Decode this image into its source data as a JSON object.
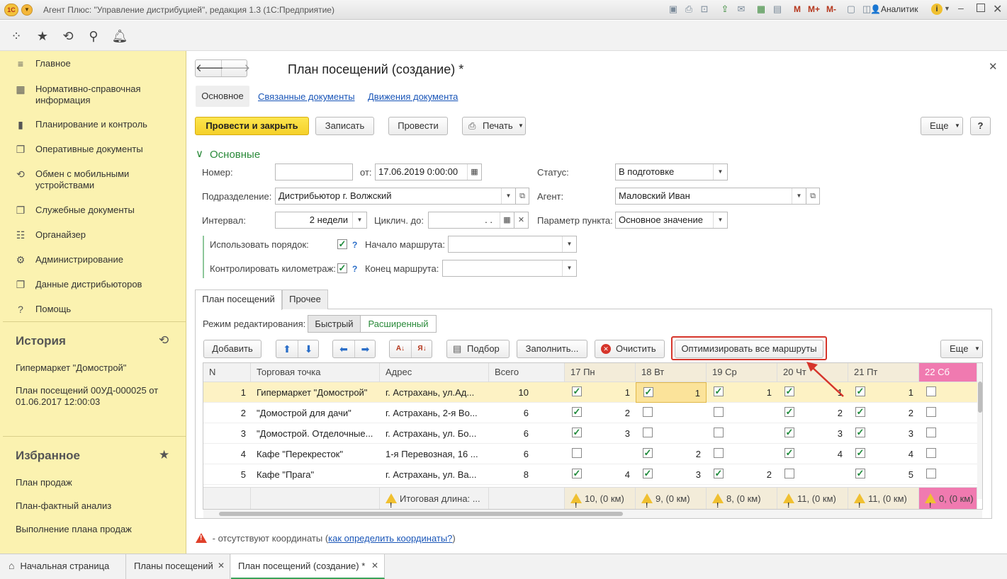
{
  "window": {
    "title": "Агент Плюс: \"Управление дистрибуцией\", редакция 1.3  (1С:Предприятие)",
    "user": "Аналитик",
    "logo_text": "1С",
    "toolbar_memory": [
      "M",
      "M+",
      "M-"
    ]
  },
  "sidebar": {
    "nav": [
      {
        "icon": "≡",
        "label": "Главное"
      },
      {
        "icon": "▦",
        "label": "Нормативно-справочная информация"
      },
      {
        "icon": "▮",
        "label": "Планирование и контроль"
      },
      {
        "icon": "❐",
        "label": "Оперативные документы"
      },
      {
        "icon": "⟲",
        "label": "Обмен с мобильными устройствами"
      },
      {
        "icon": "❐",
        "label": "Служебные документы"
      },
      {
        "icon": "☷",
        "label": "Органайзер"
      },
      {
        "icon": "⚙",
        "label": "Администрирование"
      },
      {
        "icon": "❐",
        "label": "Данные дистрибьюторов"
      },
      {
        "icon": "?",
        "label": "Помощь"
      }
    ],
    "history": {
      "title": "История",
      "items": [
        "Гипермаркет \"Домострой\"",
        "План посещений 00УД-000025 от 01.06.2017 12:00:03"
      ]
    },
    "favorites": {
      "title": "Избранное",
      "items": [
        "План продаж",
        "План-фактный анализ",
        "Выполнение плана продаж"
      ]
    }
  },
  "doc": {
    "title": "План посещений  (создание) *",
    "tabs": [
      "Основное",
      "Связанные документы",
      "Движения документа"
    ],
    "buttons": {
      "post_close": "Провести и закрыть",
      "save": "Записать",
      "post": "Провести",
      "print": "Печать",
      "more": "Еще",
      "help": "?"
    },
    "group_title": "Основные",
    "fields": {
      "number_label": "Номер:",
      "number_value": "",
      "date_label": "от:",
      "date_value": "17.06.2019  0:00:00",
      "status_label": "Статус:",
      "status_value": "В подготовке",
      "division_label": "Подразделение:",
      "division_value": "Дистрибьютор г. Волжский",
      "agent_label": "Агент:",
      "agent_value": "Маловский Иван",
      "interval_label": "Интервал:",
      "interval_value": "2 недели",
      "cyclic_label": "Циклич. до:",
      "cyclic_value": " .  .",
      "point_param_label": "Параметр пункта:",
      "point_param_value": "Основное значение",
      "use_order_label": "Использовать порядок:",
      "use_order_checked": true,
      "control_km_label": "Контролировать километраж:",
      "control_km_checked": true,
      "route_start_label": "Начало маршрута:",
      "route_start_value": "",
      "route_end_label": "Конец маршрута:",
      "route_end_value": "",
      "q_mark": "?"
    }
  },
  "plan": {
    "tabs": [
      "План посещений",
      "Прочее"
    ],
    "edit_mode_label": "Режим редактирования:",
    "edit_modes": [
      "Быстрый",
      "Расширенный"
    ],
    "buttons": {
      "add": "Добавить",
      "pick": "Подбор",
      "fill": "Заполнить...",
      "clear": "Очистить",
      "optimize": "Оптимизировать все маршруты",
      "more": "Еще"
    },
    "columns": [
      "N",
      "Торговая точка",
      "Адрес",
      "Всего"
    ],
    "days": [
      {
        "label": "17 Пн",
        "weekend": false
      },
      {
        "label": "18 Вт",
        "weekend": false
      },
      {
        "label": "19 Ср",
        "weekend": false
      },
      {
        "label": "20 Чт",
        "weekend": false
      },
      {
        "label": "21 Пт",
        "weekend": false
      },
      {
        "label": "22 Сб",
        "weekend": true
      }
    ],
    "rows": [
      {
        "n": "1",
        "point": "Гипермаркет \"Домострой\"",
        "address": "г. Астрахань, ул.Ад...",
        "total": "10",
        "days": [
          {
            "c": true,
            "v": "1"
          },
          {
            "c": true,
            "v": "1"
          },
          {
            "c": true,
            "v": "1"
          },
          {
            "c": true,
            "v": "1"
          },
          {
            "c": true,
            "v": "1"
          },
          {
            "c": false,
            "v": ""
          }
        ]
      },
      {
        "n": "2",
        "point": "\"Домострой для дачи\"",
        "address": "г. Астрахань, 2-я Во...",
        "total": "6",
        "days": [
          {
            "c": true,
            "v": "2"
          },
          {
            "c": false,
            "v": ""
          },
          {
            "c": false,
            "v": ""
          },
          {
            "c": true,
            "v": "2"
          },
          {
            "c": true,
            "v": "2"
          },
          {
            "c": false,
            "v": ""
          }
        ]
      },
      {
        "n": "3",
        "point": "\"Домострой. Отделочные...",
        "address": "г. Астрахань, ул. Бо...",
        "total": "6",
        "days": [
          {
            "c": true,
            "v": "3"
          },
          {
            "c": false,
            "v": ""
          },
          {
            "c": false,
            "v": ""
          },
          {
            "c": true,
            "v": "3"
          },
          {
            "c": true,
            "v": "3"
          },
          {
            "c": false,
            "v": ""
          }
        ]
      },
      {
        "n": "4",
        "point": "Кафе \"Перекресток\"",
        "address": "1-я Перевозная, 16 ...",
        "total": "6",
        "days": [
          {
            "c": false,
            "v": ""
          },
          {
            "c": true,
            "v": "2"
          },
          {
            "c": false,
            "v": ""
          },
          {
            "c": true,
            "v": "4"
          },
          {
            "c": true,
            "v": "4"
          },
          {
            "c": false,
            "v": ""
          }
        ]
      },
      {
        "n": "5",
        "point": "Кафе \"Прага\"",
        "address": "г. Астрахань, ул. Ва...",
        "total": "8",
        "days": [
          {
            "c": true,
            "v": "4"
          },
          {
            "c": true,
            "v": "3"
          },
          {
            "c": true,
            "v": "2"
          },
          {
            "c": false,
            "v": ""
          },
          {
            "c": true,
            "v": "5"
          },
          {
            "c": false,
            "v": ""
          }
        ]
      }
    ],
    "footer": {
      "total_length": "Итоговая длина: ...",
      "days": [
        "10, (0 км)",
        "9, (0 км)",
        "8, (0 км)",
        "11, (0 км)",
        "11, (0 км)",
        "0, (0 км)"
      ]
    },
    "note_text": " - отсутствуют координаты (",
    "note_link": "как определить координаты?",
    "note_end": ")"
  },
  "bottom_tabs": [
    "Начальная страница",
    "Планы посещений",
    "План посещений  (создание) *"
  ],
  "colors": {
    "sidebar_bg": "#fbf2b0",
    "primary_button": "#f5d02a",
    "link": "#1a56b8",
    "group_title": "#2a8a3a",
    "highlight_row": "#fdf2c4",
    "weekend_header": "#f07ab0",
    "day_header": "#f3ecd9",
    "callout": "#d6352b"
  }
}
